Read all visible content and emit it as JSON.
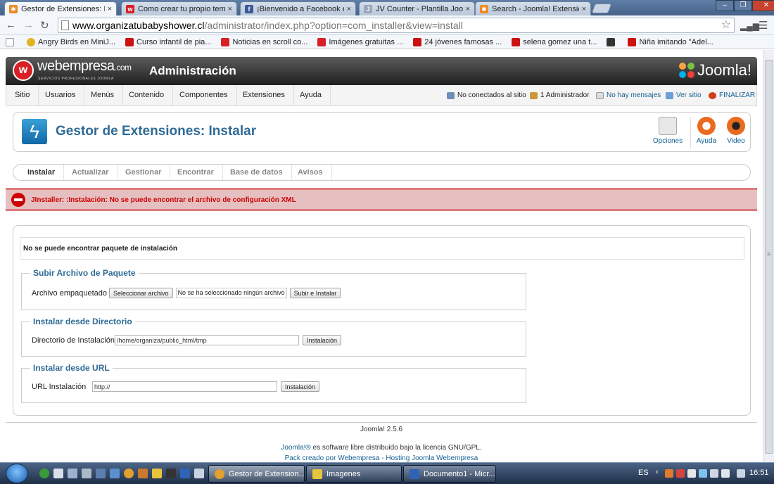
{
  "browser": {
    "tabs": [
      {
        "title": "Gestor de Extensiones: Insta",
        "active": true
      },
      {
        "title": "Como crear tu propio tem",
        "active": false
      },
      {
        "title": "¡Bienvenido a Facebook e",
        "active": false
      },
      {
        "title": "JV Counter - Plantilla Joom",
        "active": false
      },
      {
        "title": "Search - Joomla! Extension",
        "active": false
      }
    ],
    "tab_close": "×",
    "url_host": "www.organizatubabyshower.cl",
    "url_path": "/administrator/index.php?option=com_installer&view=install",
    "bookmarks": [
      {
        "label": "Angry Birds en MiniJ..."
      },
      {
        "label": "Curso infantil de pia..."
      },
      {
        "label": "Noticias en scroll co..."
      },
      {
        "label": "Imágenes gratuitas ..."
      },
      {
        "label": "24 jóvenes famosas ..."
      },
      {
        "label": "selena gomez una t..."
      },
      {
        "label": "Niña imitando \"Adel..."
      }
    ]
  },
  "header": {
    "logo_text": "webempresa",
    "logo_suffix": ".com",
    "logo_sub": "SERVICIOS PROFESIONALES JOOMLA",
    "admin_title": "Administración",
    "joomla_logo": "Joomla!"
  },
  "menu": {
    "items": [
      "Sitio",
      "Usuarios",
      "Menús",
      "Contenido",
      "Componentes",
      "Extensiones",
      "Ayuda"
    ],
    "status": {
      "not_connected": "No conectados al sitio",
      "admins": "1 Administrador",
      "messages": "No hay mensajes",
      "view_site": "Ver sitio",
      "logout": "FINALIZAR"
    }
  },
  "toolbar": {
    "title": "Gestor de Extensiones: Instalar",
    "buttons": {
      "options": "Opciones",
      "help": "Ayuda",
      "video": "Video"
    }
  },
  "submenu": {
    "items": [
      "Instalar",
      "Actualizar",
      "Gestionar",
      "Encontrar",
      "Base de datos",
      "Avisos"
    ],
    "active": "Instalar"
  },
  "error": {
    "message": "JInstaller: :Instalación: No se puede encontrar el archivo de configuración XML"
  },
  "install": {
    "notice": "No se puede encontrar paquete de instalación",
    "upload": {
      "legend": "Subir Archivo de Paquete",
      "label": "Archivo empaquetado",
      "choose_button": "Seleccionar archivo",
      "no_file": "No se ha seleccionado ningún archivo",
      "submit": "Subir e Instalar"
    },
    "directory": {
      "legend": "Instalar desde Directorio",
      "label": "Directorio de Instalación",
      "value": "/home/organiza/public_html/tmp",
      "submit": "Instalación"
    },
    "url": {
      "legend": "Instalar desde URL",
      "label": "URL Instalación",
      "value": "http://",
      "submit": "Instalación"
    }
  },
  "footer": {
    "version": "Joomla! 2.5.6",
    "license_link": "Joomla!®",
    "license_text": "es software libre distribuido bajo la licencia GNU/GPL.",
    "pack_text": "Pack creado por Webempresa - Hosting Joomla Webempresa"
  },
  "taskbar": {
    "tasks": [
      {
        "label": "Gestor de Extension...",
        "active": true
      },
      {
        "label": "Imagenes",
        "active": false
      },
      {
        "label": "Documento1 - Micr...",
        "active": false
      }
    ],
    "language": "ES",
    "clock": "16:51"
  },
  "colors": {
    "accent": "#2f6b96",
    "link": "#146295",
    "error_bg": "#e6c0c0",
    "error_text": "#cc0000",
    "header_dark": "#1f1f1f"
  }
}
